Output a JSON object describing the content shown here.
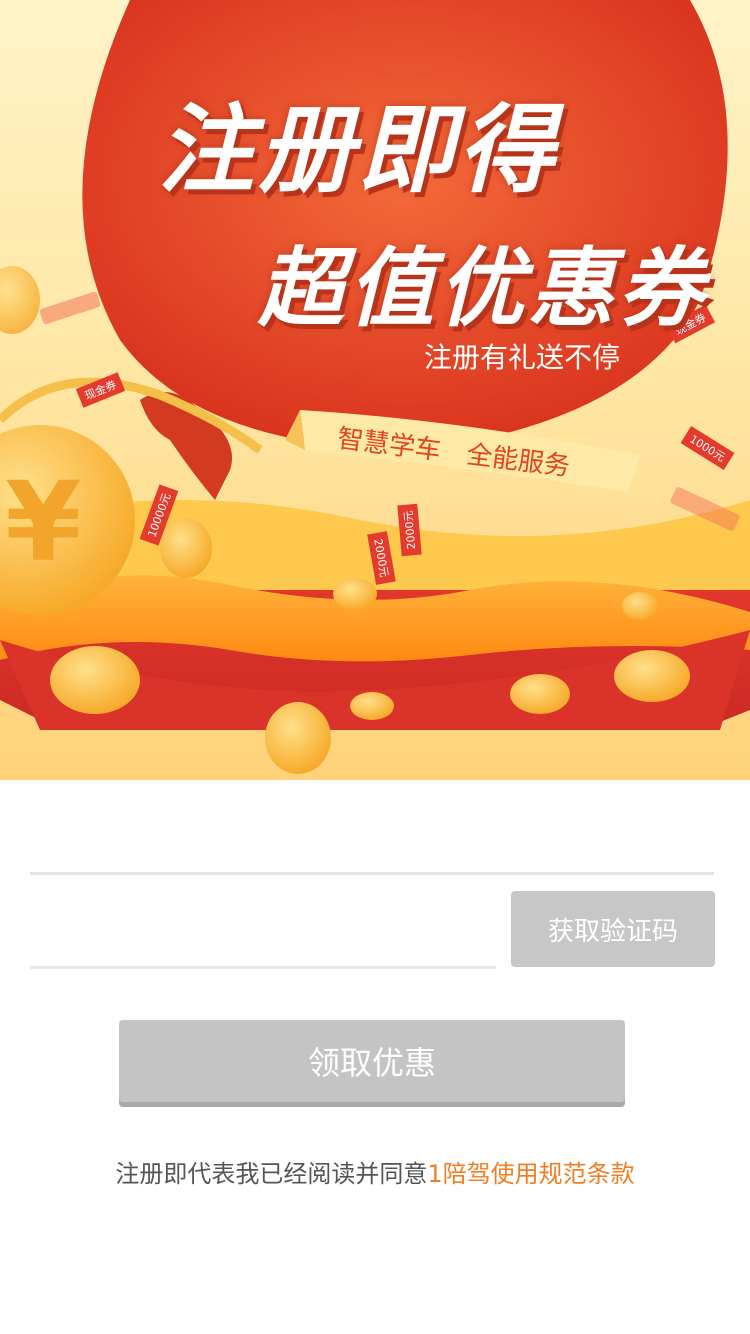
{
  "hero": {
    "title_line1": "注册即得",
    "title_line2": "超值优惠券",
    "subtitle": "注册有礼送不停",
    "banner_left": "智慧学车",
    "banner_right": "全能服务",
    "tags": [
      "现金券",
      "1000元",
      "10000元",
      "2000元",
      "现金券",
      "2000元"
    ]
  },
  "form": {
    "phone_placeholder": "",
    "code_placeholder": "",
    "get_code_label": "获取验证码",
    "submit_label": "领取优惠"
  },
  "terms": {
    "prefix": "注册即代表我已经阅读并同意",
    "link_label": "1陪驾使用规范条款"
  },
  "colors": {
    "hero_red": "#e8452a",
    "accent_orange": "#f47d23",
    "button_gray": "#c4c4c4"
  }
}
